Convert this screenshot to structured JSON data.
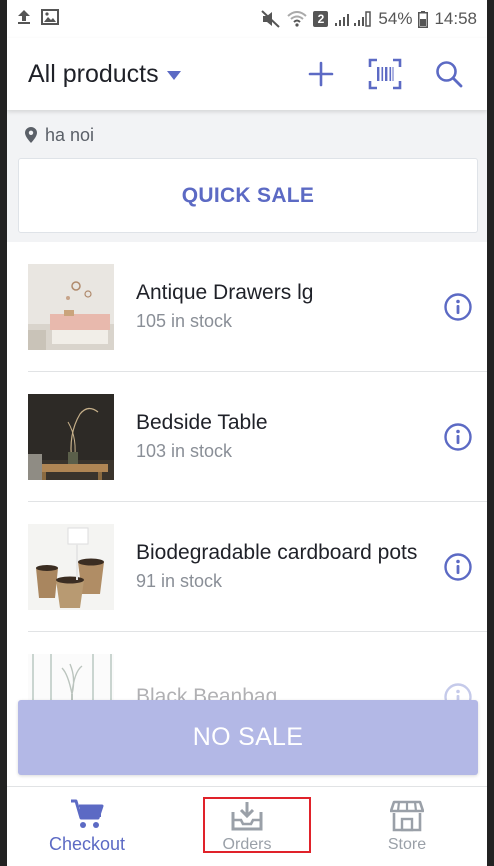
{
  "status_bar": {
    "battery": "54%",
    "time": "14:58",
    "sim_badge": "2"
  },
  "header": {
    "title": "All products"
  },
  "location": {
    "label": "ha noi"
  },
  "quick_sale": {
    "label": "QUICK SALE"
  },
  "products": [
    {
      "name": "Antique Drawers lg",
      "stock": "105 in stock"
    },
    {
      "name": "Bedside Table",
      "stock": "103 in stock"
    },
    {
      "name": "Biodegradable cardboard pots",
      "stock": "91 in stock"
    },
    {
      "name": "Black Beanbag",
      "stock": ""
    }
  ],
  "no_sale": {
    "label": "NO SALE"
  },
  "bottom_nav": {
    "items": [
      {
        "label": "Checkout",
        "icon": "cart-icon",
        "active": true
      },
      {
        "label": "Orders",
        "icon": "inbox-download-icon",
        "active": false
      },
      {
        "label": "Store",
        "icon": "store-icon",
        "active": false
      }
    ]
  },
  "colors": {
    "accent": "#5c6ac4",
    "no_sale_bg": "#b3b8e6",
    "highlight": "#e0222a"
  }
}
